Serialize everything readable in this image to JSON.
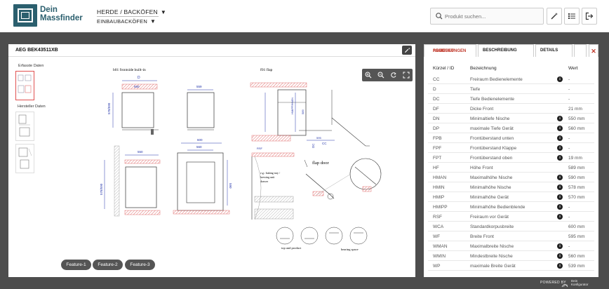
{
  "header": {
    "logo_line1": "Dein",
    "logo_line2": "Massfinder",
    "nav_category": "HERDE / BACKÖFEN",
    "nav_subcategory": "EINBAUBACKÖFEN",
    "search_placeholder": "Produkt suchen..."
  },
  "product": {
    "title": "AEG BEK43511XB",
    "side_label_1": "Erfasste Daten",
    "side_label_2": "Hersteller Daten",
    "drawing_labels": {
      "top_left": "b01 frontside built-in",
      "top_right": "f01 flap",
      "flap_door": "flap door",
      "baking_tray": "e.g.: baking tray /",
      "baking_tray2": "brewing unit",
      "baking_tray3": "drawer",
      "top_product": "top and product",
      "bearing_space": "bearing space",
      "dim_d": "D",
      "dim_560": "560",
      "dim_559": "559",
      "dim_550": "550",
      "dim_600": "600",
      "dim_590": "590",
      "dim_595": "595",
      "dim_dc": "DC",
      "dim_cc": "CC",
      "dim_rsf": "RSF"
    },
    "features": [
      "Feature-1",
      "Feature-2",
      "Feature-3"
    ]
  },
  "tabs": {
    "t1a": "PRODUKT",
    "t1b": "ABMESSUNGEN",
    "t2": "BESCHREIBUNG",
    "t3": "DETAILS",
    "close": "✕"
  },
  "table": {
    "col_id": "Kürzel / ID",
    "col_name": "Bezeichnung",
    "col_val": "Wert",
    "rows": [
      {
        "id": "CC",
        "name": "Freiraum Bedienelemente",
        "info": true,
        "val": "-"
      },
      {
        "id": "D",
        "name": "Tiefe",
        "info": false,
        "val": "-"
      },
      {
        "id": "DC",
        "name": "Tiefe Bedienelemente",
        "info": false,
        "val": "-"
      },
      {
        "id": "DF",
        "name": "Dicke Front",
        "info": false,
        "val": "21 mm"
      },
      {
        "id": "DN",
        "name": "Minimaltiefe Nische",
        "info": true,
        "val": "550 mm"
      },
      {
        "id": "DP",
        "name": "maximale Tiefe Gerät",
        "info": true,
        "val": "560 mm"
      },
      {
        "id": "FPB",
        "name": "Frontüberstand unten",
        "info": true,
        "val": "-"
      },
      {
        "id": "FPF",
        "name": "Frontüberstand Klappe",
        "info": true,
        "val": "-"
      },
      {
        "id": "FPT",
        "name": "Frontüberstand oben",
        "info": true,
        "val": "19 mm"
      },
      {
        "id": "HF",
        "name": "Höhe Front",
        "info": false,
        "val": "589 mm"
      },
      {
        "id": "HMAN",
        "name": "Maximalhöhe Nische",
        "info": true,
        "val": "590 mm"
      },
      {
        "id": "HMIN",
        "name": "Minimalhöhe Nische",
        "info": true,
        "val": "578 mm"
      },
      {
        "id": "HMIP",
        "name": "Minimalhöhe Gerät",
        "info": true,
        "val": "570 mm"
      },
      {
        "id": "HMIPP",
        "name": "Minimalhöhe Bedienblende",
        "info": true,
        "val": "-"
      },
      {
        "id": "RSF",
        "name": "Freiraum vor Gerät",
        "info": true,
        "val": "-"
      },
      {
        "id": "WCA",
        "name": "Standardkorpusbreite",
        "info": false,
        "val": "600 mm"
      },
      {
        "id": "WF",
        "name": "Breite Front",
        "info": false,
        "val": "595 mm"
      },
      {
        "id": "WMAN",
        "name": "Maximalbreite Nische",
        "info": true,
        "val": "-"
      },
      {
        "id": "WMIN",
        "name": "Mindestbreite Nische",
        "info": true,
        "val": "560 mm"
      },
      {
        "id": "WP",
        "name": "maximale Breite Gerät",
        "info": true,
        "val": "539 mm"
      }
    ]
  },
  "footer": {
    "powered": "POWERED BY",
    "brand_line1": "Dein",
    "brand_line2": "Konfigurator"
  },
  "colors": {
    "accent": "#c0392b",
    "brand": "#2b5f6e",
    "dim_blue": "#2233aa",
    "hatch_red": "#e07070"
  }
}
